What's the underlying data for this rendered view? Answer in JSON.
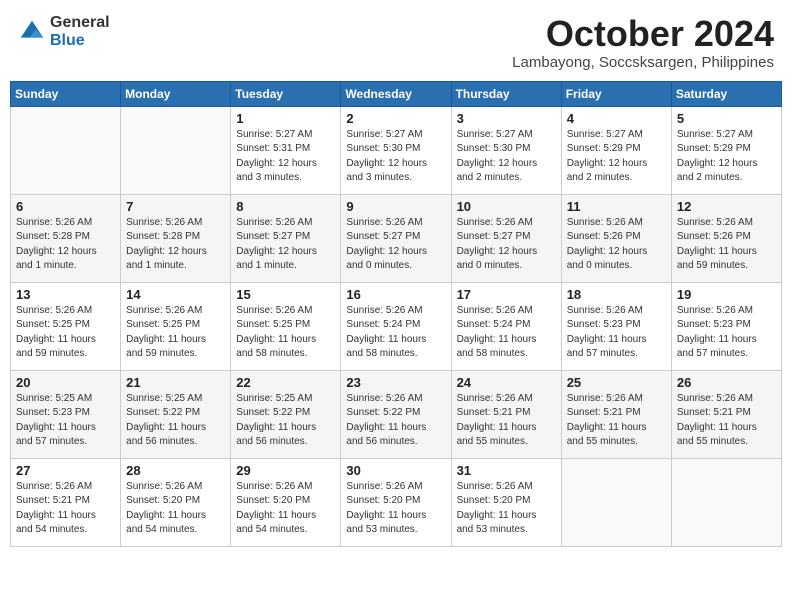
{
  "logo": {
    "general": "General",
    "blue": "Blue"
  },
  "title": "October 2024",
  "location": "Lambayong, Soccsksargen, Philippines",
  "days_of_week": [
    "Sunday",
    "Monday",
    "Tuesday",
    "Wednesday",
    "Thursday",
    "Friday",
    "Saturday"
  ],
  "weeks": [
    [
      {
        "day": "",
        "info": ""
      },
      {
        "day": "",
        "info": ""
      },
      {
        "day": "1",
        "info": "Sunrise: 5:27 AM\nSunset: 5:31 PM\nDaylight: 12 hours\nand 3 minutes."
      },
      {
        "day": "2",
        "info": "Sunrise: 5:27 AM\nSunset: 5:30 PM\nDaylight: 12 hours\nand 3 minutes."
      },
      {
        "day": "3",
        "info": "Sunrise: 5:27 AM\nSunset: 5:30 PM\nDaylight: 12 hours\nand 2 minutes."
      },
      {
        "day": "4",
        "info": "Sunrise: 5:27 AM\nSunset: 5:29 PM\nDaylight: 12 hours\nand 2 minutes."
      },
      {
        "day": "5",
        "info": "Sunrise: 5:27 AM\nSunset: 5:29 PM\nDaylight: 12 hours\nand 2 minutes."
      }
    ],
    [
      {
        "day": "6",
        "info": "Sunrise: 5:26 AM\nSunset: 5:28 PM\nDaylight: 12 hours\nand 1 minute."
      },
      {
        "day": "7",
        "info": "Sunrise: 5:26 AM\nSunset: 5:28 PM\nDaylight: 12 hours\nand 1 minute."
      },
      {
        "day": "8",
        "info": "Sunrise: 5:26 AM\nSunset: 5:27 PM\nDaylight: 12 hours\nand 1 minute."
      },
      {
        "day": "9",
        "info": "Sunrise: 5:26 AM\nSunset: 5:27 PM\nDaylight: 12 hours\nand 0 minutes."
      },
      {
        "day": "10",
        "info": "Sunrise: 5:26 AM\nSunset: 5:27 PM\nDaylight: 12 hours\nand 0 minutes."
      },
      {
        "day": "11",
        "info": "Sunrise: 5:26 AM\nSunset: 5:26 PM\nDaylight: 12 hours\nand 0 minutes."
      },
      {
        "day": "12",
        "info": "Sunrise: 5:26 AM\nSunset: 5:26 PM\nDaylight: 11 hours\nand 59 minutes."
      }
    ],
    [
      {
        "day": "13",
        "info": "Sunrise: 5:26 AM\nSunset: 5:25 PM\nDaylight: 11 hours\nand 59 minutes."
      },
      {
        "day": "14",
        "info": "Sunrise: 5:26 AM\nSunset: 5:25 PM\nDaylight: 11 hours\nand 59 minutes."
      },
      {
        "day": "15",
        "info": "Sunrise: 5:26 AM\nSunset: 5:25 PM\nDaylight: 11 hours\nand 58 minutes."
      },
      {
        "day": "16",
        "info": "Sunrise: 5:26 AM\nSunset: 5:24 PM\nDaylight: 11 hours\nand 58 minutes."
      },
      {
        "day": "17",
        "info": "Sunrise: 5:26 AM\nSunset: 5:24 PM\nDaylight: 11 hours\nand 58 minutes."
      },
      {
        "day": "18",
        "info": "Sunrise: 5:26 AM\nSunset: 5:23 PM\nDaylight: 11 hours\nand 57 minutes."
      },
      {
        "day": "19",
        "info": "Sunrise: 5:26 AM\nSunset: 5:23 PM\nDaylight: 11 hours\nand 57 minutes."
      }
    ],
    [
      {
        "day": "20",
        "info": "Sunrise: 5:25 AM\nSunset: 5:23 PM\nDaylight: 11 hours\nand 57 minutes."
      },
      {
        "day": "21",
        "info": "Sunrise: 5:25 AM\nSunset: 5:22 PM\nDaylight: 11 hours\nand 56 minutes."
      },
      {
        "day": "22",
        "info": "Sunrise: 5:25 AM\nSunset: 5:22 PM\nDaylight: 11 hours\nand 56 minutes."
      },
      {
        "day": "23",
        "info": "Sunrise: 5:26 AM\nSunset: 5:22 PM\nDaylight: 11 hours\nand 56 minutes."
      },
      {
        "day": "24",
        "info": "Sunrise: 5:26 AM\nSunset: 5:21 PM\nDaylight: 11 hours\nand 55 minutes."
      },
      {
        "day": "25",
        "info": "Sunrise: 5:26 AM\nSunset: 5:21 PM\nDaylight: 11 hours\nand 55 minutes."
      },
      {
        "day": "26",
        "info": "Sunrise: 5:26 AM\nSunset: 5:21 PM\nDaylight: 11 hours\nand 55 minutes."
      }
    ],
    [
      {
        "day": "27",
        "info": "Sunrise: 5:26 AM\nSunset: 5:21 PM\nDaylight: 11 hours\nand 54 minutes."
      },
      {
        "day": "28",
        "info": "Sunrise: 5:26 AM\nSunset: 5:20 PM\nDaylight: 11 hours\nand 54 minutes."
      },
      {
        "day": "29",
        "info": "Sunrise: 5:26 AM\nSunset: 5:20 PM\nDaylight: 11 hours\nand 54 minutes."
      },
      {
        "day": "30",
        "info": "Sunrise: 5:26 AM\nSunset: 5:20 PM\nDaylight: 11 hours\nand 53 minutes."
      },
      {
        "day": "31",
        "info": "Sunrise: 5:26 AM\nSunset: 5:20 PM\nDaylight: 11 hours\nand 53 minutes."
      },
      {
        "day": "",
        "info": ""
      },
      {
        "day": "",
        "info": ""
      }
    ]
  ]
}
